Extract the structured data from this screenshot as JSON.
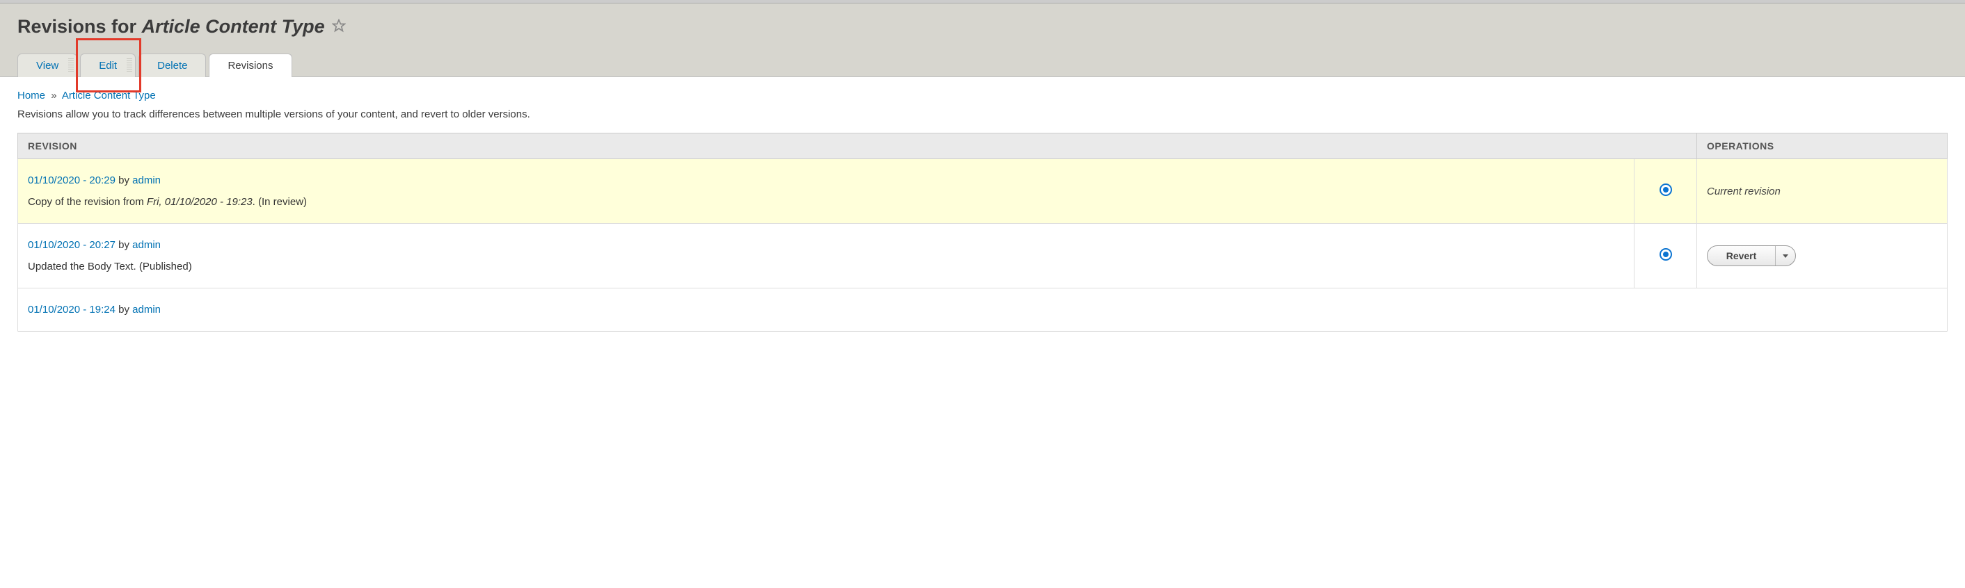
{
  "page": {
    "title_prefix": "Revisions for",
    "title_subject": "Article Content Type"
  },
  "tabs": {
    "view": "View",
    "edit": "Edit",
    "delete": "Delete",
    "revisions": "Revisions"
  },
  "breadcrumb": {
    "home": "Home",
    "separator": "»",
    "item": "Article Content Type"
  },
  "help": "Revisions allow you to track differences between multiple versions of your content, and revert to older versions.",
  "table": {
    "header_revision": "REVISION",
    "header_operations": "OPERATIONS"
  },
  "rows": [
    {
      "date": "01/10/2020 - 20:29",
      "by_word": "by",
      "author": "admin",
      "desc_prefix": "Copy of the revision from ",
      "desc_italic": "Fri, 01/10/2020 - 19:23",
      "desc_suffix": ". (In review)",
      "ops_label": "Current revision"
    },
    {
      "date": "01/10/2020 - 20:27",
      "by_word": "by",
      "author": "admin",
      "desc_full": "Updated the Body Text. (Published)",
      "ops_button": "Revert"
    },
    {
      "date": "01/10/2020 - 19:24",
      "by_word": "by",
      "author": "admin"
    }
  ]
}
